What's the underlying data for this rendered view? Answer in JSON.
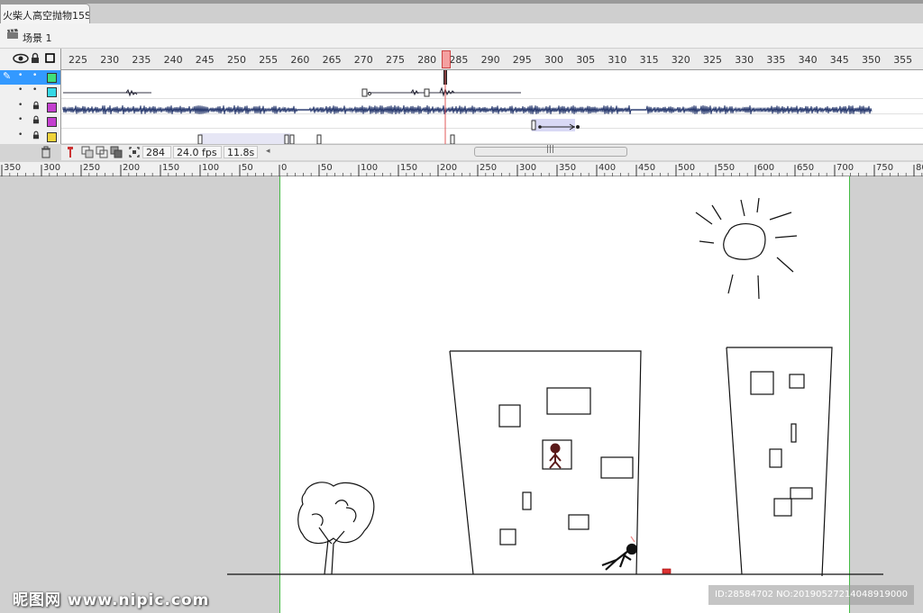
{
  "document": {
    "tab_title": "火柴人高空抛物15S*"
  },
  "scene": {
    "label": "场景 1",
    "icon": "clapperboard-icon"
  },
  "timeline": {
    "frame_numbers": [
      "225",
      "230",
      "235",
      "240",
      "245",
      "250",
      "255",
      "260",
      "265",
      "270",
      "275",
      "280",
      "285",
      "290",
      "295",
      "300",
      "305",
      "310",
      "315",
      "320",
      "325",
      "330",
      "335",
      "340",
      "345",
      "350",
      "355"
    ],
    "header_icons": [
      "eye-icon",
      "lock-icon",
      "outline-icon"
    ],
    "layers": [
      {
        "color": "#3fe07a",
        "state": "pencil",
        "active": true
      },
      {
        "color": "#35d8e6",
        "state": "dots",
        "active": false
      },
      {
        "color": "#c33fcf",
        "state": "locked",
        "active": false
      },
      {
        "color": "#c33fcf",
        "state": "locked",
        "active": false
      },
      {
        "color": "#f0d33a",
        "state": "locked",
        "active": false
      }
    ],
    "current_frame": "284",
    "fps": "24.0 fps",
    "elapsed": "11.8s",
    "playhead_color": "#e0585a"
  },
  "stage_ruler": {
    "labels": [
      "350",
      "300",
      "250",
      "200",
      "150",
      "100",
      "50",
      "0",
      "50",
      "100",
      "150",
      "200",
      "250",
      "300",
      "350",
      "400",
      "450",
      "500",
      "550",
      "600",
      "650",
      "700",
      "750",
      "80"
    ]
  },
  "watermark": {
    "logo": "昵图网 www.nipic.com",
    "id": "ID:28584702 NO:20190527214048919000"
  },
  "colors": {
    "stage_border": "#44bb44",
    "accent": "#3399ff"
  }
}
